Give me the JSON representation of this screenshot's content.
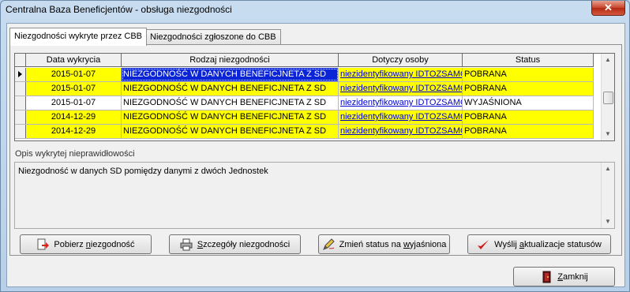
{
  "window": {
    "title": "Centralna Baza Beneficjentów - obsługa niezgodności",
    "close_label": "✕"
  },
  "tabs": [
    {
      "label": "Niezgodności wykryte przez CBB",
      "active": true
    },
    {
      "label": "Niezgodności zgłoszone do CBB",
      "active": false
    }
  ],
  "grid": {
    "columns": [
      "Data wykrycia",
      "Rodzaj niezgodności",
      "Dotyczy osoby",
      "Status"
    ],
    "rows": [
      {
        "date": "2015-01-07",
        "type": "NIEZGODNOŚĆ  W DANYCH BENEFICJNETA Z SD",
        "person": "niezidentyfikowany IDTOZSAMO",
        "status": "POBRANA",
        "color": "#ffff00",
        "current": true
      },
      {
        "date": "2015-01-07",
        "type": "NIEZGODNOŚĆ  W DANYCH BENEFICJNETA Z SD",
        "person": "niezidentyfikowany IDTOZSAMO",
        "status": "POBRANA",
        "color": "#ffff00",
        "current": false
      },
      {
        "date": "2015-01-07",
        "type": "NIEZGODNOŚĆ  W DANYCH BENEFICJNETA Z SD",
        "person": "niezidentyfikowany IDTOZSAMO",
        "status": "WYJAŚNIONA",
        "color": "#ffffff",
        "current": false
      },
      {
        "date": "2014-12-29",
        "type": "NIEZGODNOŚĆ  W DANYCH BENEFICJNETA Z SD",
        "person": "niezidentyfikowany IDTOZSAMO",
        "status": "POBRANA",
        "color": "#ffff00",
        "current": false
      },
      {
        "date": "2014-12-29",
        "type": "NIEZGODNOŚĆ  W DANYCH BENEFICJNETA Z SD",
        "person": "niezidentyfikowany IDTOZSAMO",
        "status": "POBRANA",
        "color": "#ffff00",
        "current": false
      }
    ]
  },
  "description": {
    "label": "Opis wykrytej nieprawidłowości",
    "text": "Niezgodność w danych SD pomiędzy danymi z dwóch Jednostek"
  },
  "buttons": {
    "fetch": {
      "pre": "Pobierz ",
      "u": "n",
      "post": "iezgodność"
    },
    "details": {
      "pre": "",
      "u": "S",
      "post": "zczegóły niezgodności"
    },
    "change": {
      "pre": "Zmień status na ",
      "u": "w",
      "post": "yjaśniona"
    },
    "send": {
      "pre": "Wyślij ",
      "u": "a",
      "post": "ktualizacje statusów"
    },
    "close": {
      "pre": "",
      "u": "Z",
      "post": "amknij"
    }
  },
  "colors": {
    "highlight": "#ffff00",
    "selection": "#0a24d6",
    "link": "#0000cc"
  }
}
